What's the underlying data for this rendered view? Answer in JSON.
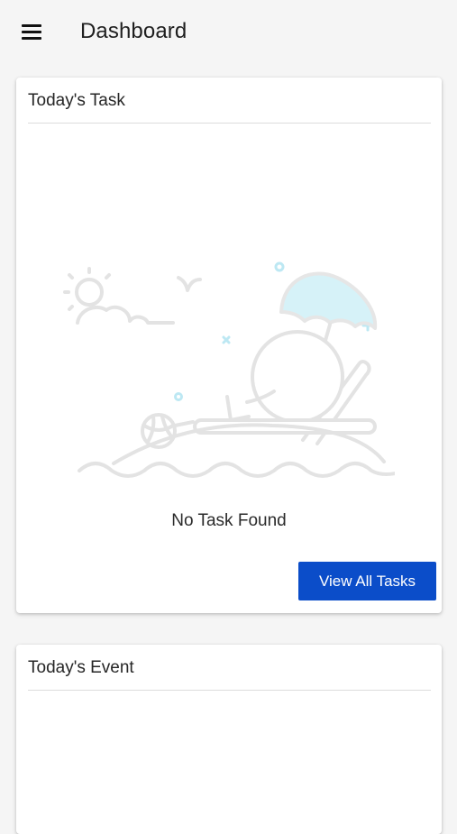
{
  "header": {
    "title": "Dashboard",
    "menu_icon": "hamburger-menu-icon"
  },
  "task_card": {
    "title": "Today's Task",
    "empty_message": "No Task Found",
    "illustration_icon": "beach-relax-illustration",
    "button_label": "View All Tasks"
  },
  "event_card": {
    "title": "Today's Event"
  },
  "colors": {
    "background": "#f5f5f5",
    "card": "#ffffff",
    "primary_button": "#0b4dc9",
    "umbrella": "#d4f1f9",
    "illustration_stroke": "#e6e6e6",
    "accent_dots": "#bde8f3"
  }
}
